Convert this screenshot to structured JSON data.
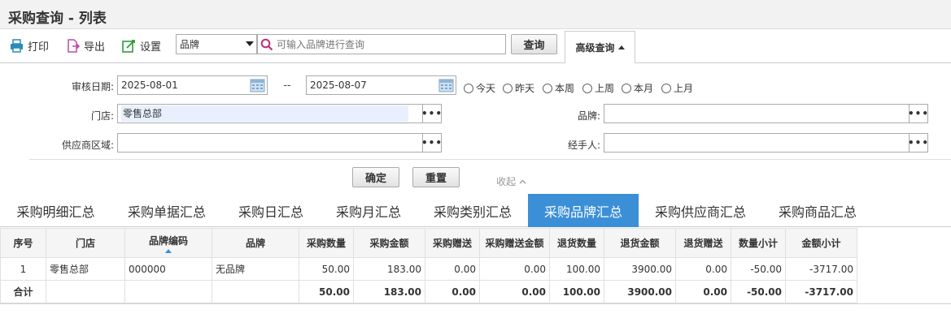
{
  "page": {
    "title": "采购查询 - 列表"
  },
  "toolbar": {
    "print": "打印",
    "export": "导出",
    "settings": "设置",
    "select_value": "品牌",
    "search_placeholder": "可输入品牌进行查询",
    "query": "查询",
    "advanced": "高级查询"
  },
  "filters": {
    "audit_date_label": "审核日期:",
    "date_from": "2025-08-01",
    "date_sep": "--",
    "date_to": "2025-08-07",
    "radios": [
      "今天",
      "昨天",
      "本周",
      "上周",
      "本月",
      "上月"
    ],
    "store_label": "门店:",
    "store_value": "零售总部",
    "brand_label": "品牌:",
    "brand_value": "",
    "supplier_area_label": "供应商区域:",
    "supplier_area_value": "",
    "handler_label": "经手人:",
    "handler_value": "",
    "dots": "•••",
    "confirm": "确定",
    "reset": "重置",
    "collapse": "收起"
  },
  "tabs": [
    "采购明细汇总",
    "采购单据汇总",
    "采购日汇总",
    "采购月汇总",
    "采购类别汇总",
    "采购品牌汇总",
    "采购供应商汇总",
    "采购商品汇总"
  ],
  "active_tab_index": 5,
  "table": {
    "columns": [
      "序号",
      "门店",
      "品牌编码",
      "品牌",
      "采购数量",
      "采购金额",
      "采购赠送",
      "采购赠送金额",
      "退货数量",
      "退货金额",
      "退货赠送",
      "数量小计",
      "金额小计"
    ],
    "rows": [
      [
        "1",
        "零售总部",
        "000000",
        "无品牌",
        "50.00",
        "183.00",
        "0.00",
        "0.00",
        "100.00",
        "3900.00",
        "0.00",
        "-50.00",
        "-3717.00"
      ]
    ],
    "total": [
      "合计",
      "",
      "",
      "",
      "50.00",
      "183.00",
      "0.00",
      "0.00",
      "100.00",
      "3900.00",
      "0.00",
      "-50.00",
      "-3717.00"
    ]
  },
  "colors": {
    "accent": "#3b8fd6",
    "search_icon": "#c0307a",
    "print_icon": "#2a8ab8",
    "export_icon": "#c04aa8",
    "settings_icon": "#2e9a3e"
  }
}
